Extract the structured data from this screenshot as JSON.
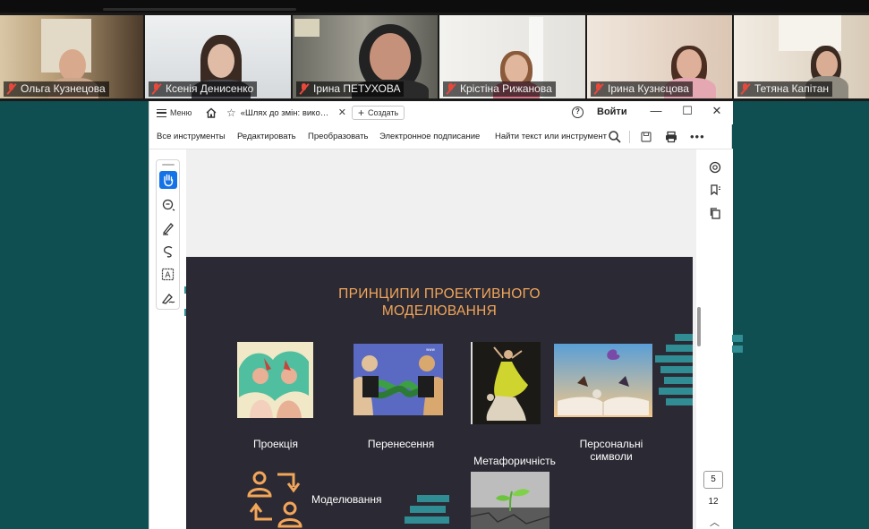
{
  "participants": [
    {
      "name": "Ольга Кузнецова",
      "muted": true
    },
    {
      "name": "Ксенія Денисенко",
      "muted": true
    },
    {
      "name": "Ірина ПЕТУХОВА",
      "muted": true
    },
    {
      "name": "Крістіна Рижанова",
      "muted": true
    },
    {
      "name": "Ірина Кузнєцова",
      "muted": true
    },
    {
      "name": "Тетяна Капітан",
      "muted": true
    }
  ],
  "titlebar": {
    "menu_label": "Меню",
    "tab_title": "«Шлях до змін: вико…",
    "create_label": "Создать",
    "signin_label": "Войти"
  },
  "toolbar": {
    "all_tools": "Все инструменты",
    "edit": "Редактировать",
    "convert": "Преобразовать",
    "esign": "Электронное подписание",
    "find": "Найти текст или инструмент"
  },
  "pager": {
    "current": "5",
    "total": "12"
  },
  "slide": {
    "title_line1": "ПРИНЦИПИ ПРОЕКТИВНОГО",
    "title_line2": "МОДЕЛЮВАННЯ",
    "captions": {
      "projection": "Проекція",
      "transfer": "Перенесення",
      "metaphor": "Метафоричність",
      "symbols_line1": "Персональні",
      "symbols_line2": "символи",
      "modeling": "Моделювання"
    }
  },
  "colors": {
    "slide_bg": "#2b2933",
    "title_orange": "#f2a65a",
    "accent_blue": "#1473e6",
    "mute_red": "#e8483b",
    "teal_bg": "#0f4f52"
  }
}
